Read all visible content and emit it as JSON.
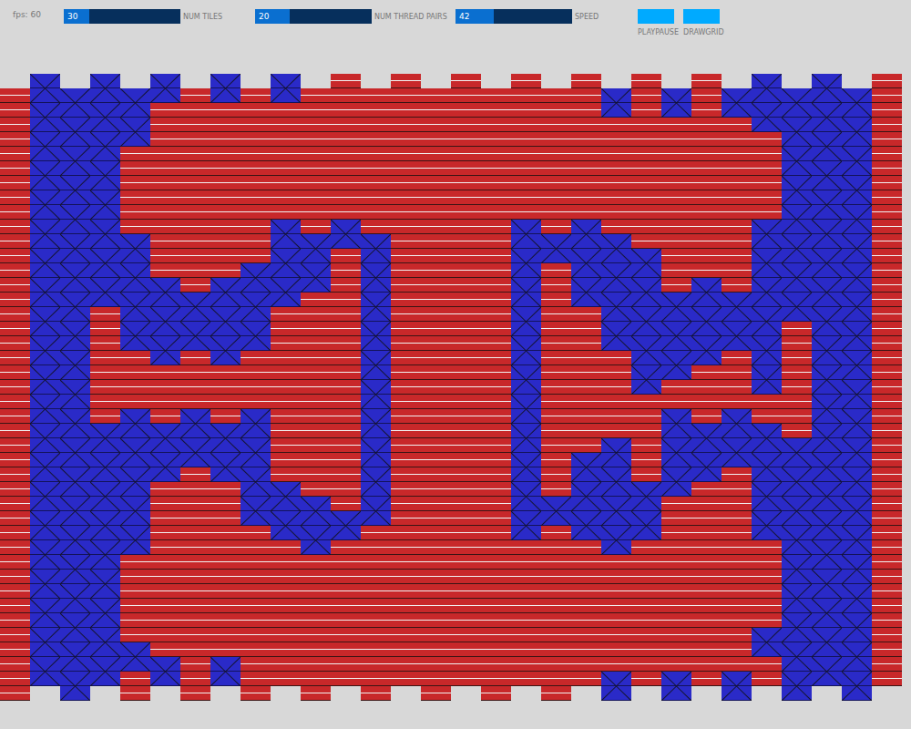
{
  "fps": "fps: 60",
  "sliders": [
    {
      "label": "NUM TILES",
      "value": "30",
      "level": 0.22
    },
    {
      "label": "NUM THREAD PAIRS",
      "value": "20",
      "level": 0.3
    },
    {
      "label": "SPEED",
      "value": "42",
      "level": 0.33
    }
  ],
  "buttons": [
    "PLAYPAUSE",
    "DRAWGRID"
  ],
  "weave": {
    "columns": [
      [
        0,
        0,
        0,
        0,
        0,
        0,
        0,
        0,
        0,
        0,
        0,
        0,
        0,
        0,
        0,
        0,
        0,
        0,
        0,
        0,
        0
      ],
      [
        1,
        1,
        1,
        1,
        1,
        1,
        1,
        1,
        1,
        1,
        1,
        1,
        1,
        1,
        1,
        1,
        1,
        1,
        1,
        1,
        1
      ],
      [
        1,
        1,
        1,
        1,
        1,
        1,
        1,
        1,
        1,
        1,
        1,
        1,
        1,
        1,
        1,
        1,
        1,
        1,
        1,
        1,
        1
      ],
      [
        1,
        1,
        1,
        1,
        1,
        1,
        1,
        1,
        0,
        0,
        0,
        0,
        1,
        1,
        1,
        1,
        1,
        1,
        1,
        1,
        1
      ],
      [
        1,
        1,
        0,
        0,
        0,
        1,
        1,
        1,
        1,
        0,
        0,
        1,
        1,
        1,
        1,
        1,
        0,
        0,
        0,
        1,
        0
      ],
      [
        1,
        0,
        0,
        0,
        0,
        0,
        0,
        1,
        1,
        1,
        0,
        0,
        1,
        1,
        0,
        0,
        0,
        0,
        0,
        0,
        1
      ],
      [
        0,
        0,
        0,
        0,
        0,
        0,
        0,
        1,
        1,
        0,
        0,
        1,
        1,
        0,
        0,
        0,
        0,
        0,
        0,
        0,
        0
      ],
      [
        1,
        0,
        0,
        0,
        0,
        0,
        0,
        1,
        1,
        1,
        0,
        0,
        1,
        1,
        0,
        0,
        0,
        0,
        0,
        0,
        1
      ],
      [
        0,
        0,
        0,
        0,
        0,
        0,
        1,
        1,
        1,
        0,
        0,
        1,
        1,
        1,
        1,
        0,
        0,
        0,
        0,
        0,
        0
      ],
      [
        1,
        0,
        0,
        0,
        0,
        1,
        1,
        1,
        0,
        0,
        0,
        0,
        0,
        0,
        1,
        1,
        0,
        0,
        0,
        0,
        0
      ],
      [
        0,
        0,
        0,
        0,
        0,
        1,
        1,
        0,
        0,
        0,
        0,
        0,
        0,
        0,
        1,
        1,
        0,
        0,
        0,
        0,
        0
      ],
      [
        0,
        0,
        0,
        0,
        0,
        1,
        0,
        0,
        0,
        0,
        0,
        0,
        0,
        0,
        0,
        1,
        0,
        0,
        0,
        0,
        0
      ],
      [
        0,
        0,
        0,
        0,
        0,
        1,
        1,
        1,
        1,
        1,
        1,
        1,
        1,
        1,
        1,
        0,
        0,
        0,
        0,
        0,
        0
      ],
      [
        0,
        0,
        0,
        0,
        0,
        0,
        0,
        0,
        0,
        0,
        0,
        0,
        0,
        0,
        0,
        0,
        0,
        0,
        0,
        0,
        0
      ],
      [
        0,
        0,
        0,
        0,
        0,
        0,
        0,
        0,
        0,
        0,
        0,
        0,
        0,
        0,
        0,
        0,
        0,
        0,
        0,
        0,
        0
      ],
      [
        0,
        0,
        0,
        0,
        0,
        0,
        0,
        0,
        0,
        0,
        0,
        0,
        0,
        0,
        0,
        0,
        0,
        0,
        0,
        0,
        0
      ],
      [
        0,
        0,
        0,
        0,
        0,
        0,
        0,
        0,
        0,
        0,
        0,
        0,
        0,
        0,
        0,
        0,
        0,
        0,
        0,
        0,
        0
      ],
      [
        0,
        0,
        0,
        0,
        0,
        1,
        1,
        1,
        1,
        1,
        1,
        1,
        1,
        1,
        1,
        1,
        0,
        0,
        0,
        0,
        0
      ],
      [
        0,
        0,
        0,
        0,
        0,
        1,
        0,
        0,
        0,
        0,
        0,
        0,
        0,
        0,
        1,
        0,
        0,
        0,
        0,
        0,
        0
      ],
      [
        0,
        0,
        0,
        0,
        0,
        1,
        1,
        1,
        0,
        0,
        0,
        0,
        0,
        1,
        1,
        1,
        0,
        0,
        0,
        0,
        0
      ],
      [
        1,
        0,
        0,
        0,
        0,
        1,
        1,
        1,
        1,
        0,
        0,
        0,
        1,
        1,
        1,
        1,
        0,
        0,
        0,
        0,
        1
      ],
      [
        0,
        0,
        0,
        0,
        0,
        0,
        1,
        1,
        1,
        1,
        1,
        0,
        0,
        0,
        1,
        1,
        0,
        0,
        0,
        0,
        0
      ],
      [
        1,
        0,
        0,
        0,
        0,
        0,
        0,
        1,
        1,
        1,
        0,
        1,
        1,
        1,
        0,
        0,
        0,
        0,
        0,
        0,
        1
      ],
      [
        0,
        0,
        0,
        0,
        0,
        0,
        0,
        1,
        1,
        1,
        0,
        0,
        1,
        1,
        0,
        0,
        0,
        0,
        0,
        0,
        0
      ],
      [
        1,
        0,
        0,
        0,
        0,
        0,
        0,
        1,
        1,
        0,
        0,
        1,
        1,
        0,
        0,
        0,
        0,
        0,
        0,
        0,
        1
      ],
      [
        1,
        1,
        0,
        0,
        0,
        1,
        1,
        1,
        1,
        1,
        1,
        0,
        1,
        1,
        1,
        1,
        0,
        0,
        0,
        1,
        0
      ],
      [
        1,
        1,
        1,
        1,
        1,
        1,
        1,
        1,
        0,
        0,
        0,
        0,
        1,
        1,
        1,
        1,
        1,
        1,
        1,
        1,
        1
      ],
      [
        1,
        1,
        1,
        1,
        1,
        1,
        1,
        1,
        1,
        1,
        1,
        1,
        1,
        1,
        1,
        1,
        1,
        1,
        1,
        1,
        1
      ],
      [
        1,
        1,
        1,
        1,
        1,
        1,
        1,
        1,
        1,
        1,
        1,
        1,
        1,
        1,
        1,
        1,
        1,
        1,
        1,
        1,
        1
      ],
      [
        0,
        0,
        0,
        0,
        0,
        0,
        0,
        0,
        0,
        0,
        0,
        0,
        0,
        0,
        0,
        0,
        0,
        0,
        0,
        0,
        0
      ]
    ]
  }
}
